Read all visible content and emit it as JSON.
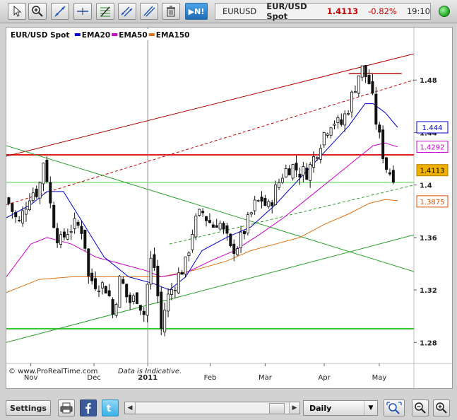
{
  "toolbar": {
    "tools": [
      {
        "icon": "cursor-icon"
      },
      {
        "icon": "zoom-plus-icon"
      },
      {
        "icon": "trendline-icon"
      },
      {
        "icon": "horizontal-line-icon"
      },
      {
        "icon": "fibonacci-icon"
      },
      {
        "icon": "channel-icon"
      },
      {
        "icon": "parallel-lines-icon"
      },
      {
        "icon": "trash-icon"
      }
    ],
    "play_label": "▶N!",
    "symbol": "EURUSD",
    "instrument": "EUR/USD Spot",
    "price": "1.4113",
    "change": "-0.82%",
    "time": "19:10",
    "status_color": "#2db52d"
  },
  "chart_data": {
    "type": "candlestick",
    "legend": [
      {
        "name": "EUR/USD Spot",
        "color": "#000000"
      },
      {
        "name": "EMA20",
        "color": "#0000cc"
      },
      {
        "name": "EMA50",
        "color": "#cc00cc"
      },
      {
        "name": "EMA150",
        "color": "#e07010"
      }
    ],
    "y_ticks": [
      "1.48",
      "1.44",
      "1.4",
      "1.36",
      "1.32",
      "1.28"
    ],
    "x_ticks": [
      "Nov",
      "Dec",
      "2011",
      "Feb",
      "Mar",
      "Apr",
      "May"
    ],
    "ylim": [
      1.264,
      1.52
    ],
    "xlim": [
      0,
      100
    ],
    "price_labels": [
      {
        "text": "1.444",
        "value": 1.444,
        "color": "#0000cc",
        "bg": "#ffffff"
      },
      {
        "text": "1.4292",
        "value": 1.4292,
        "color": "#cc00cc",
        "bg": "#ffffff"
      },
      {
        "text": "1.4113",
        "value": 1.4113,
        "color": "#000000",
        "bg": "#f0b000"
      },
      {
        "text": "1.3875",
        "value": 1.3875,
        "color": "#e05000",
        "bg": "#ffffff"
      }
    ],
    "horizontal_lines": [
      {
        "value": 1.423,
        "color": "#e02020",
        "width": 2
      },
      {
        "value": 1.402,
        "color": "#4ad04a",
        "width": 1
      },
      {
        "value": 1.2905,
        "color": "#2ec82e",
        "width": 2
      }
    ],
    "trend_lines": [
      {
        "from": [
          0,
          1.422
        ],
        "to": [
          100,
          1.5
        ],
        "color": "#b00000",
        "dash": false
      },
      {
        "from": [
          0,
          1.385
        ],
        "to": [
          100,
          1.48
        ],
        "color": "#c00000",
        "dash": true
      },
      {
        "from": [
          0,
          1.43
        ],
        "to": [
          100,
          1.334
        ],
        "color": "#2aa02a",
        "dash": false
      },
      {
        "from": [
          0,
          1.28
        ],
        "to": [
          100,
          1.362
        ],
        "color": "#2aa02a",
        "dash": false
      },
      {
        "from": [
          40,
          1.355
        ],
        "to": [
          100,
          1.4
        ],
        "color": "#2aa02a",
        "dash": true
      }
    ],
    "short_line": {
      "from": [
        84,
        1.485
      ],
      "to": [
        97,
        1.485
      ],
      "color": "#b00000"
    },
    "vertical_line": {
      "x": 34.7,
      "color": "#808080"
    },
    "close_points": [
      [
        0,
        1.39
      ],
      [
        3,
        1.37
      ],
      [
        6,
        1.395
      ],
      [
        8,
        1.395
      ],
      [
        9,
        1.42
      ],
      [
        10,
        1.405
      ],
      [
        11,
        1.38
      ],
      [
        13,
        1.355
      ],
      [
        15,
        1.365
      ],
      [
        17,
        1.37
      ],
      [
        19,
        1.365
      ],
      [
        20,
        1.33
      ],
      [
        22,
        1.325
      ],
      [
        23,
        1.325
      ],
      [
        25,
        1.32
      ],
      [
        26,
        1.3
      ],
      [
        28,
        1.33
      ],
      [
        30,
        1.31
      ],
      [
        32,
        1.315
      ],
      [
        34,
        1.3
      ],
      [
        35,
        1.34
      ],
      [
        36,
        1.345
      ],
      [
        37,
        1.32
      ],
      [
        38,
        1.29
      ],
      [
        39,
        1.308
      ],
      [
        40,
        1.318
      ],
      [
        41,
        1.322
      ],
      [
        42,
        1.33
      ],
      [
        44,
        1.34
      ],
      [
        46,
        1.37
      ],
      [
        48,
        1.38
      ],
      [
        49,
        1.375
      ],
      [
        51,
        1.368
      ],
      [
        52,
        1.375
      ],
      [
        53,
        1.365
      ],
      [
        54,
        1.36
      ],
      [
        55,
        1.35
      ],
      [
        57,
        1.355
      ],
      [
        59,
        1.37
      ],
      [
        61,
        1.385
      ],
      [
        63,
        1.39
      ],
      [
        64,
        1.38
      ],
      [
        66,
        1.396
      ],
      [
        68,
        1.41
      ],
      [
        70,
        1.415
      ],
      [
        72,
        1.41
      ],
      [
        74,
        1.41
      ],
      [
        76,
        1.425
      ],
      [
        78,
        1.44
      ],
      [
        80,
        1.45
      ],
      [
        82,
        1.445
      ],
      [
        84,
        1.46
      ],
      [
        86,
        1.48
      ],
      [
        87,
        1.49
      ],
      [
        89,
        1.478
      ],
      [
        90,
        1.462
      ],
      [
        91,
        1.443
      ],
      [
        92,
        1.43
      ],
      [
        93,
        1.415
      ],
      [
        94,
        1.41
      ],
      [
        95,
        1.408
      ]
    ],
    "ema20": [
      [
        0,
        1.375
      ],
      [
        6,
        1.385
      ],
      [
        10,
        1.395
      ],
      [
        14,
        1.395
      ],
      [
        18,
        1.375
      ],
      [
        24,
        1.345
      ],
      [
        30,
        1.33
      ],
      [
        36,
        1.325
      ],
      [
        40,
        1.32
      ],
      [
        44,
        1.33
      ],
      [
        48,
        1.35
      ],
      [
        54,
        1.36
      ],
      [
        60,
        1.368
      ],
      [
        66,
        1.385
      ],
      [
        72,
        1.405
      ],
      [
        78,
        1.425
      ],
      [
        84,
        1.445
      ],
      [
        88,
        1.462
      ],
      [
        90,
        1.462
      ],
      [
        93,
        1.455
      ],
      [
        96,
        1.444
      ]
    ],
    "ema50": [
      [
        0,
        1.33
      ],
      [
        6,
        1.355
      ],
      [
        10,
        1.36
      ],
      [
        16,
        1.355
      ],
      [
        22,
        1.345
      ],
      [
        28,
        1.34
      ],
      [
        34,
        1.335
      ],
      [
        38,
        1.33
      ],
      [
        44,
        1.333
      ],
      [
        50,
        1.342
      ],
      [
        56,
        1.35
      ],
      [
        62,
        1.362
      ],
      [
        68,
        1.375
      ],
      [
        74,
        1.39
      ],
      [
        80,
        1.405
      ],
      [
        86,
        1.42
      ],
      [
        90,
        1.43
      ],
      [
        93,
        1.432
      ],
      [
        96,
        1.429
      ]
    ],
    "ema150": [
      [
        0,
        1.318
      ],
      [
        8,
        1.328
      ],
      [
        16,
        1.33
      ],
      [
        24,
        1.33
      ],
      [
        32,
        1.33
      ],
      [
        38,
        1.33
      ],
      [
        46,
        1.335
      ],
      [
        54,
        1.342
      ],
      [
        60,
        1.35
      ],
      [
        66,
        1.355
      ],
      [
        72,
        1.36
      ],
      [
        78,
        1.37
      ],
      [
        84,
        1.378
      ],
      [
        89,
        1.386
      ],
      [
        93,
        1.389
      ],
      [
        96,
        1.388
      ]
    ],
    "watermark": "© www.ProRealTime.com",
    "note": "Data is Indicative."
  },
  "bottom": {
    "settings_label": "Settings",
    "period": "Daily",
    "scroll_left": "◀",
    "scroll_right": "▶",
    "dropdown_arrow": "▼"
  }
}
